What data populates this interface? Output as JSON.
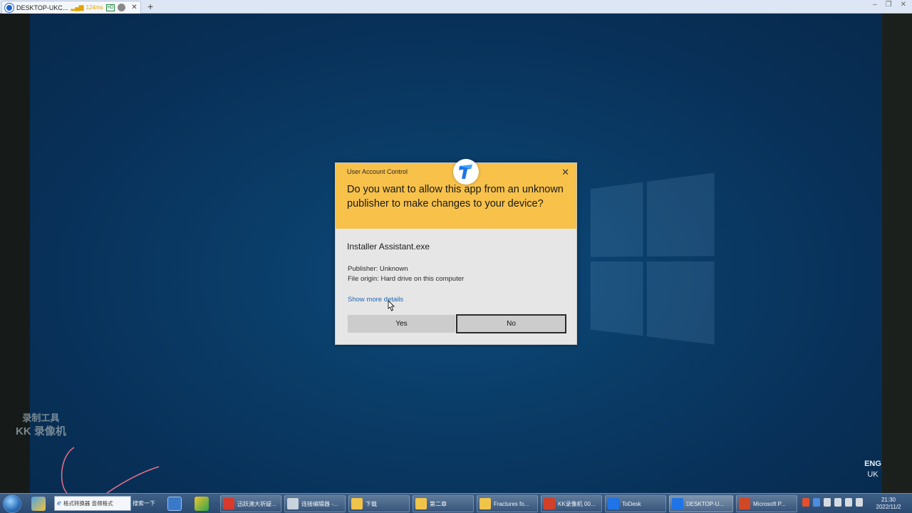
{
  "remote_tab": {
    "title": "DESKTOP-UKC...",
    "latency": "124ms",
    "quality_badge": "HD",
    "close": "✕",
    "add": "+"
  },
  "window_controls": {
    "minimize": "–",
    "restore": "❐",
    "close": "✕"
  },
  "uac": {
    "caption": "User Account Control",
    "close": "✕",
    "question": "Do you want to allow this app from an unknown publisher to make changes to your device?",
    "app_name": "Installer Assistant.exe",
    "publisher": "Publisher: Unknown",
    "file_origin": "File origin: Hard drive on this computer",
    "more_details": "Show more details",
    "yes": "Yes",
    "no": "No"
  },
  "watermark": {
    "line1": "录制工具",
    "line2": "KK 录像机"
  },
  "language": {
    "code": "ENG",
    "region": "UK"
  },
  "taskbar": {
    "search_text": "格式转换器 音频格式",
    "search_button": "搜索一下",
    "items": [
      {
        "label": "迅跃澳大祈疑...",
        "icon": "chrome-icon",
        "color": "#d93a2b"
      },
      {
        "label": "连接编辑器 -...",
        "icon": "clock-app-icon",
        "color": "#c9d3dd"
      },
      {
        "label": "下载",
        "icon": "folder-icon",
        "color": "#f0c44a"
      },
      {
        "label": "第二章",
        "icon": "folder-icon",
        "color": "#f0c44a"
      },
      {
        "label": "Fractures fo...",
        "icon": "folder-icon",
        "color": "#f0c44a"
      },
      {
        "label": "KK录像机 00...",
        "icon": "kk-recorder-icon",
        "color": "#d2402a"
      },
      {
        "label": "ToDesk",
        "icon": "todesk-icon",
        "color": "#1f74e8"
      },
      {
        "label": "DESKTOP-U...",
        "icon": "todesk-icon",
        "color": "#1f74e8"
      },
      {
        "label": "Microsoft P...",
        "icon": "powerpoint-icon",
        "color": "#d24726"
      }
    ],
    "time": "21:30",
    "date": "2022/11/2"
  },
  "colors": {
    "uac_header": "#f7c14a",
    "uac_body": "#e6e6e6",
    "link": "#1d66b8",
    "desktop": "#0a3d68"
  }
}
